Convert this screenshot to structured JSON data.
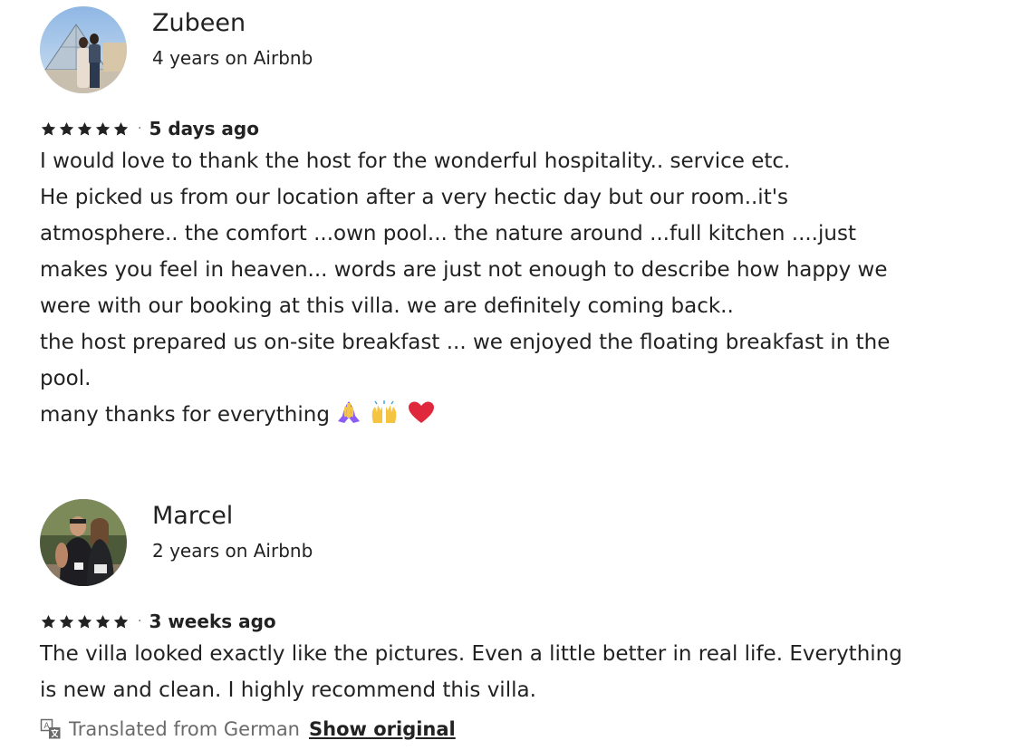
{
  "reviews": [
    {
      "name": "Zubeen",
      "tenure": "4 years on Airbnb",
      "rating": 5,
      "date": "5 days ago",
      "text": "I would love to thank the host for the wonderful hospitality.. service etc.\nHe picked us from our location after a very hectic day but our room..it's\natmosphere.. the comfort ...own pool... the nature around ...full kitchen ....just\nmakes you feel in heaven... words are just not enough to describe how happy we\nwere with our booking at this villa. we are definitely coming back..\nthe host prepared us on-site breakfast ... we enjoyed the floating breakfast in the\npool.\nmany thanks for everything"
    },
    {
      "name": "Marcel",
      "tenure": "2 years on Airbnb",
      "rating": 5,
      "date": "3 weeks ago",
      "text": "The villa looked exactly like the pictures. Even a little better in real life. Everything\nis new and clean. I highly recommend this villa.",
      "translated_label": "Translated from German",
      "show_original_label": "Show original"
    }
  ],
  "separator": "·",
  "icons": {
    "star": "star-icon",
    "translate": "translate-icon",
    "emoji_1": "folded-hands-icon",
    "emoji_2": "raised-hands-icon",
    "emoji_3": "red-heart-icon"
  },
  "colors": {
    "text": "#222222",
    "muted": "#6a6a6a",
    "star": "#222222",
    "heart": "#e0283d"
  }
}
